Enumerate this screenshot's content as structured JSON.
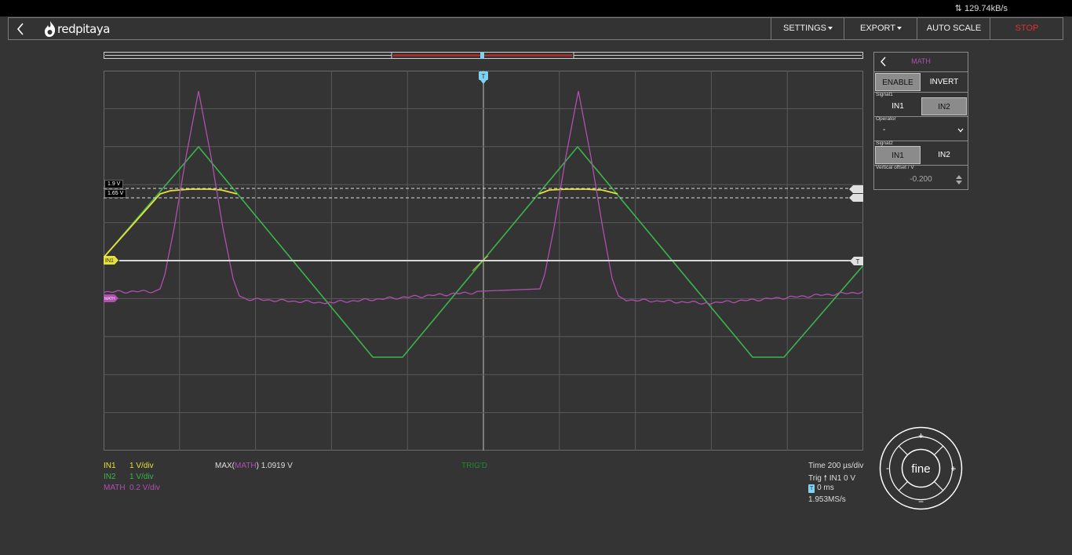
{
  "status": {
    "data_rate": "129.74kB/s"
  },
  "header": {
    "logo_text": "redpitaya",
    "settings_label": "SETTINGS",
    "export_label": "EXPORT",
    "autoscale_label": "AUTO SCALE",
    "stop_label": "STOP"
  },
  "colors": {
    "in1": "#e8e03a",
    "in2": "#3cb44b",
    "math": "#b04fb0",
    "trigger": "#7fd3f0",
    "stop": "#e03030"
  },
  "cursors": {
    "cursor1_label": "1.9 V",
    "cursor2_label": "1.65 V"
  },
  "markers": {
    "in1_marker": "IN1",
    "math_marker": "MATH",
    "trigger_marker": "T"
  },
  "channels": [
    {
      "name": "IN1",
      "scale": "1 V/div"
    },
    {
      "name": "IN2",
      "scale": "1 V/div"
    },
    {
      "name": "MATH",
      "scale": "0.2 V/div"
    }
  ],
  "measurement": {
    "prefix": "MAX(",
    "channel": "MATH",
    "suffix": ") 1.0919 V"
  },
  "trigger_state": "TRIG'D",
  "timebase": {
    "time_div": "Time 200 µs/div",
    "trig_info": "IN1 0 V",
    "trig_prefix": "Trig",
    "offset": "0 ms",
    "sample_rate": "1.953MS/s"
  },
  "math_panel": {
    "title": "MATH",
    "enable_label": "ENABLE",
    "invert_label": "INVERT",
    "signal1_label": "Signal1",
    "signal1_options": [
      "IN1",
      "IN2"
    ],
    "signal1_selected": "IN2",
    "operator_label": "Operator",
    "operator_value": "-",
    "signal2_label": "Signal2",
    "signal2_options": [
      "IN1",
      "IN2"
    ],
    "signal2_selected": "IN1",
    "offset_label": "Vertical offset / V",
    "offset_value": "-0.200"
  },
  "jog": {
    "center_label": "fine",
    "plus": "+",
    "minus": "−",
    "minus_left": "-",
    "plus_right": "+"
  }
}
